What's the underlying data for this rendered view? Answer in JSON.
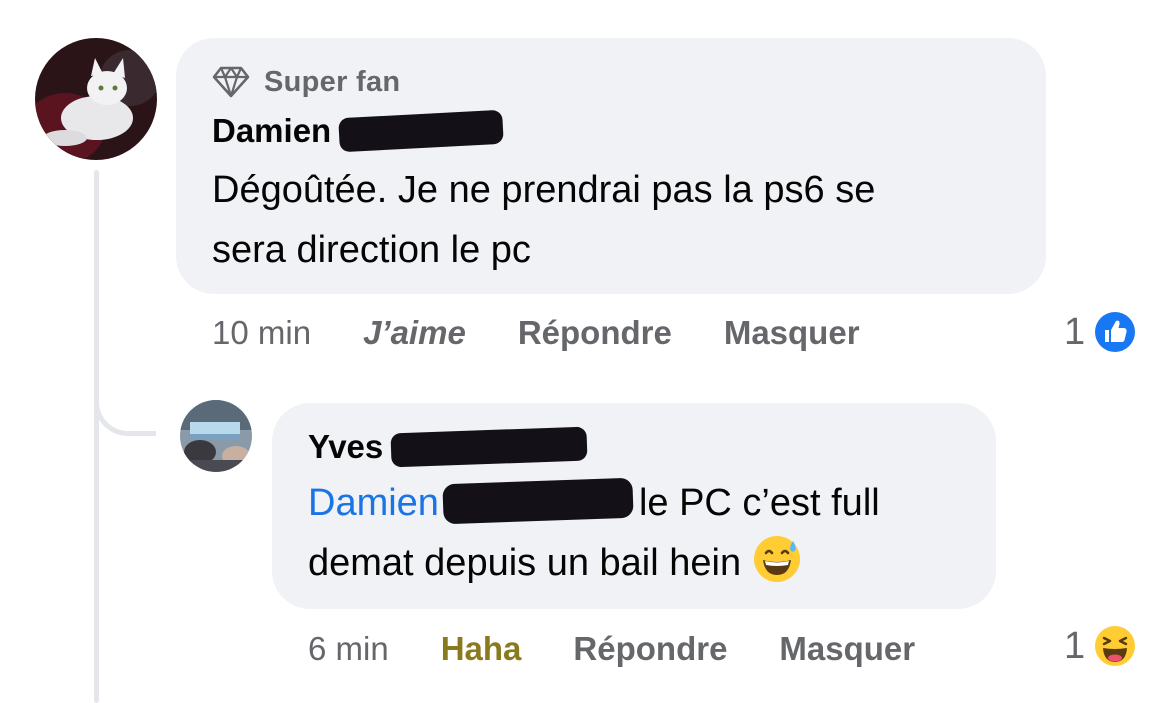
{
  "comment1": {
    "badge": "Super fan",
    "author": "Damien",
    "text_line1": "Dégoûtée. Je ne prendrai pas la ps6 se",
    "text_line2": "sera direction le pc",
    "time": "10 min",
    "like_label": "J’aime",
    "reply_label": "Répondre",
    "hide_label": "Masquer",
    "reaction_count": "1",
    "reaction_icon": "like-icon"
  },
  "reply1": {
    "author": "Yves",
    "mention": "Damien",
    "text_line1_rest": "le PC c’est full",
    "text_line2": "demat depuis un bail hein",
    "emoji": "grinning-sweat-emoji",
    "time": "6 min",
    "reaction_label": "Haha",
    "reply_label": "Répondre",
    "hide_label": "Masquer",
    "reaction_count": "1",
    "reaction_icon": "haha-icon"
  },
  "colors": {
    "bubble": "#f0f2f5",
    "mention": "#1b74e4",
    "haha": "#8a7a1e",
    "like_blue": "#1877f2",
    "thread_line": "#e4e6eb"
  }
}
